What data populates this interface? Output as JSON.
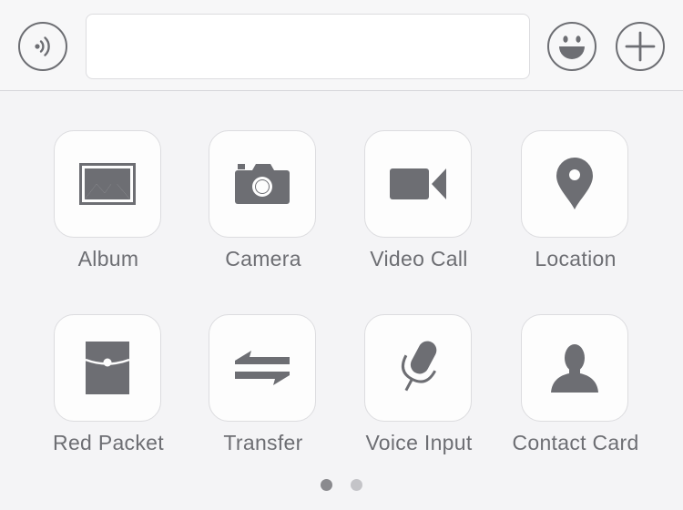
{
  "input_bar": {
    "voice_icon": "voice-wave-icon",
    "message_value": "",
    "message_placeholder": "",
    "emoji_icon": "emoji-smile-icon",
    "more_icon": "plus-icon"
  },
  "panel": {
    "items": [
      {
        "label": "Album",
        "icon": "image-icon"
      },
      {
        "label": "Camera",
        "icon": "camera-icon"
      },
      {
        "label": "Video Call",
        "icon": "video-camera-icon"
      },
      {
        "label": "Location",
        "icon": "map-pin-icon"
      },
      {
        "label": "Red Packet",
        "icon": "red-packet-icon"
      },
      {
        "label": "Transfer",
        "icon": "transfer-arrows-icon"
      },
      {
        "label": "Voice Input",
        "icon": "microphone-icon"
      },
      {
        "label": "Contact Card",
        "icon": "person-icon"
      }
    ],
    "page_indicator": {
      "pages": 2,
      "current": 1
    }
  },
  "colors": {
    "background": "#f4f4f6",
    "icon": "#6d6e73",
    "dot_active": "#8a8a8e",
    "dot_inactive": "#c4c4c8"
  }
}
